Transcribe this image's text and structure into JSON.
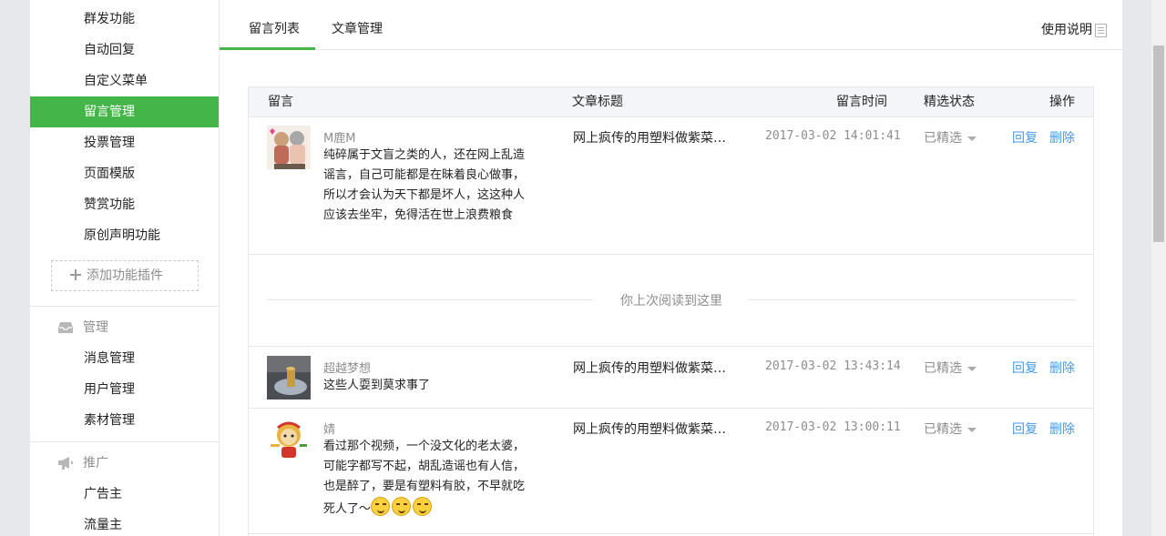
{
  "sidebar": {
    "feature_items": [
      {
        "label": "群发功能"
      },
      {
        "label": "自动回复"
      },
      {
        "label": "自定义菜单"
      },
      {
        "label": "留言管理",
        "active": true
      },
      {
        "label": "投票管理"
      },
      {
        "label": "页面模版"
      },
      {
        "label": "赞赏功能"
      },
      {
        "label": "原创声明功能"
      }
    ],
    "add_plugin_label": "添加功能插件",
    "manage": {
      "title": "管理",
      "icon": "inbox-icon",
      "items": [
        {
          "label": "消息管理"
        },
        {
          "label": "用户管理"
        },
        {
          "label": "素材管理"
        }
      ]
    },
    "promote": {
      "title": "推广",
      "icon": "megaphone-icon",
      "items": [
        {
          "label": "广告主"
        },
        {
          "label": "流量主"
        }
      ]
    }
  },
  "tabs": [
    {
      "label": "留言列表",
      "active": true
    },
    {
      "label": "文章管理",
      "active": false
    }
  ],
  "help_label": "使用说明",
  "table": {
    "headers": {
      "comment": "留言",
      "article": "文章标题",
      "time": "留言时间",
      "status": "精选状态",
      "actions": "操作"
    },
    "rows": [
      {
        "nickname": "M鹿M",
        "content": "纯碎属于文盲之类的人，还在网上乱造谣言，自己可能都是在昧着良心做事，所以才会认为天下都是坏人，这这种人应该去坐牢，免得活在世上浪费粮食",
        "article": "网上疯传的用塑料做紫菜…",
        "time": "2017-03-02 14:01:41",
        "status": "已精选",
        "reply": "回复",
        "delete": "删除"
      },
      {
        "nickname": "超越梦想",
        "content": "这些人耍到莫求事了",
        "article": "网上疯传的用塑料做紫菜…",
        "time": "2017-03-02 13:43:14",
        "status": "已精选",
        "reply": "回复",
        "delete": "删除"
      },
      {
        "nickname": "婧",
        "content": "看过那个视频，一个没文化的老太婆，可能字都写不起，胡乱造谣也有人信，也是醉了，要是有塑料有胶，不早就吃死人了～",
        "emoji_count": 3,
        "article": "网上疯传的用塑料做紫菜…",
        "time": "2017-03-02 13:00:11",
        "status": "已精选",
        "reply": "回复",
        "delete": "删除"
      }
    ],
    "last_read_label": "你上次阅读到这里"
  },
  "colors": {
    "accent": "#44b549",
    "link": "#459ae9",
    "muted": "#8d8d8d"
  }
}
